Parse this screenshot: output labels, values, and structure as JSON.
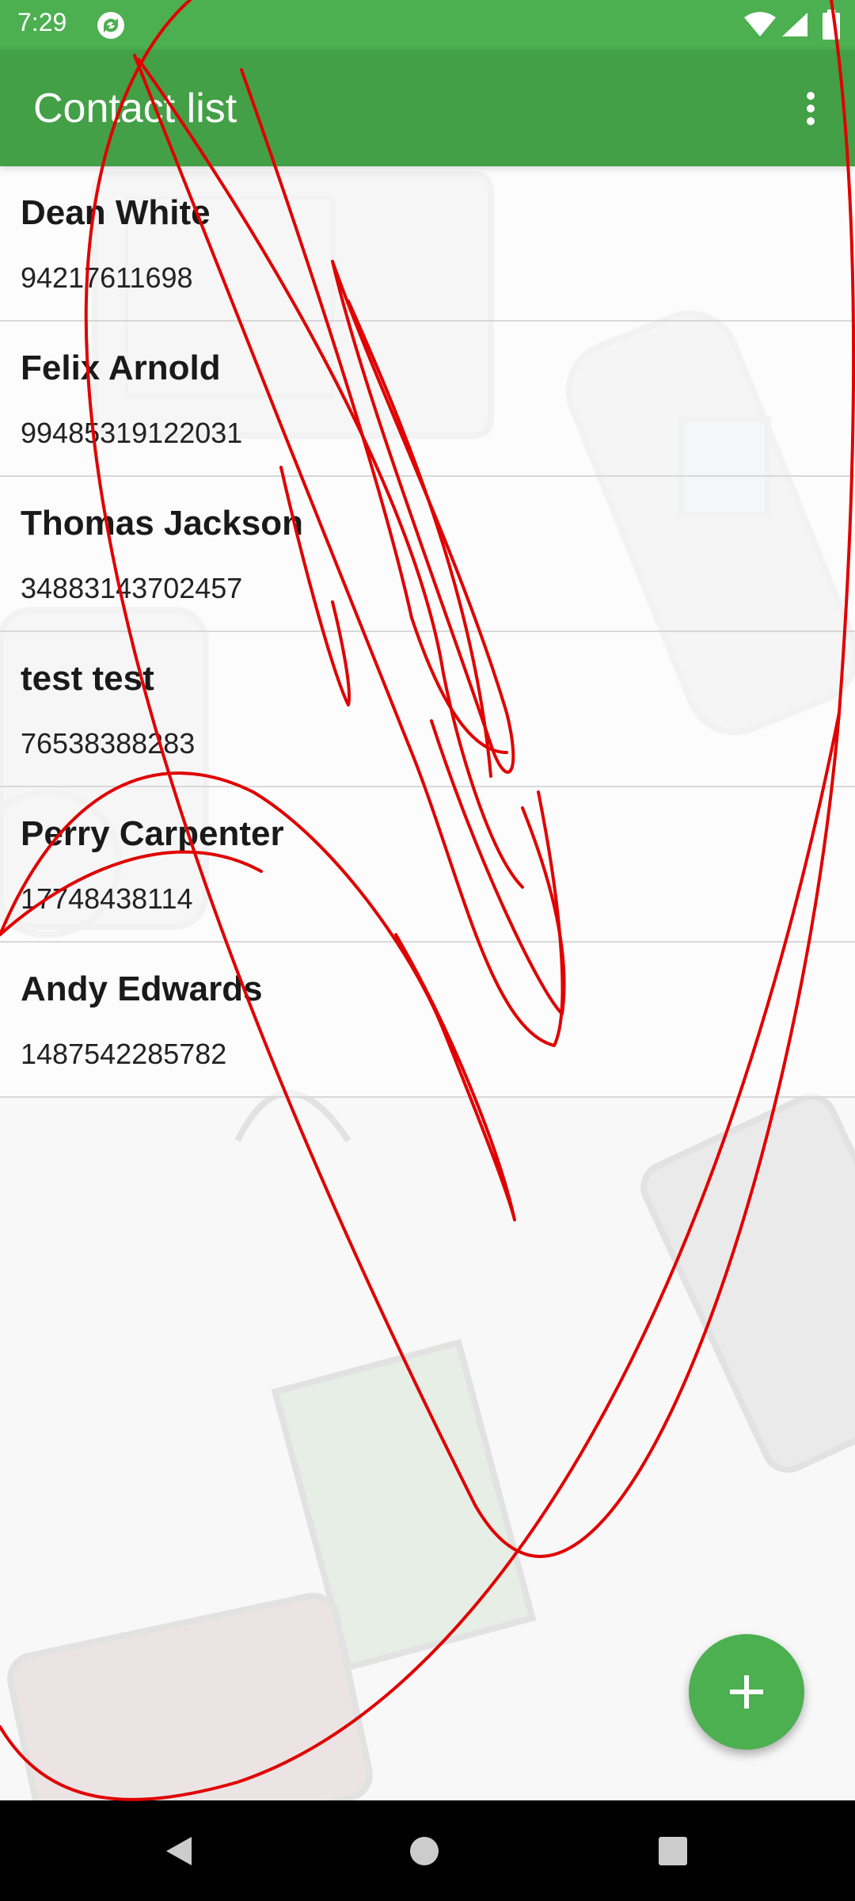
{
  "status_bar": {
    "time": "7:29",
    "icons": [
      "sync-icon",
      "wifi-icon",
      "signal-icon",
      "battery-icon"
    ]
  },
  "app_bar": {
    "title": "Contact list",
    "menu_icon": "overflow-menu-icon"
  },
  "contacts": [
    {
      "name": "Dean White",
      "phone": "94217611698"
    },
    {
      "name": "Felix Arnold",
      "phone": "99485319122031"
    },
    {
      "name": "Thomas Jackson",
      "phone": "34883143702457"
    },
    {
      "name": "test test",
      "phone": "76538388283"
    },
    {
      "name": "Perry Carpenter",
      "phone": "17748438114"
    },
    {
      "name": "Andy Edwards",
      "phone": "1487542285782"
    }
  ],
  "fab": {
    "icon": "plus-icon"
  },
  "nav_bar": {
    "icons": [
      "back-icon",
      "home-icon",
      "recents-icon"
    ]
  },
  "colors": {
    "status_bar": "#4CAF50",
    "app_bar": "#43A047",
    "fab": "#4CAF50",
    "annotation": "#E00000"
  }
}
